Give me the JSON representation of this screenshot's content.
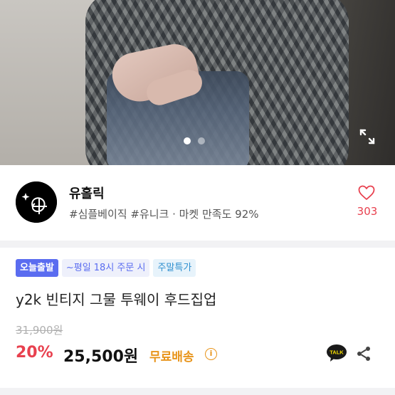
{
  "product_image": {
    "icon": "product-photo",
    "slide_count": 2,
    "active_slide": 1,
    "expand_icon": "expand-icon"
  },
  "seller": {
    "name": "유홀릭",
    "tags": "#심플베이직 #유니크 · 마켓 만족도 92%",
    "likes": "303",
    "heart_icon": "heart-icon"
  },
  "badges": {
    "today": "오늘출발",
    "weekday": "~평일 18시 주문 시",
    "weekend": "주말특가"
  },
  "product": {
    "title": "y2k 빈티지 그물 투웨이 후드집업",
    "original_price": "31,900원",
    "discount": "20%",
    "price": "25,500원",
    "shipping": "무료배송",
    "info_icon": "i"
  },
  "actions": {
    "talk_label": "TALK",
    "share_icon": "share-icon"
  },
  "colors": {
    "accent_red": "#e8414f",
    "badge_blue": "#5a6cf0",
    "shipping_orange": "#e8941a"
  }
}
